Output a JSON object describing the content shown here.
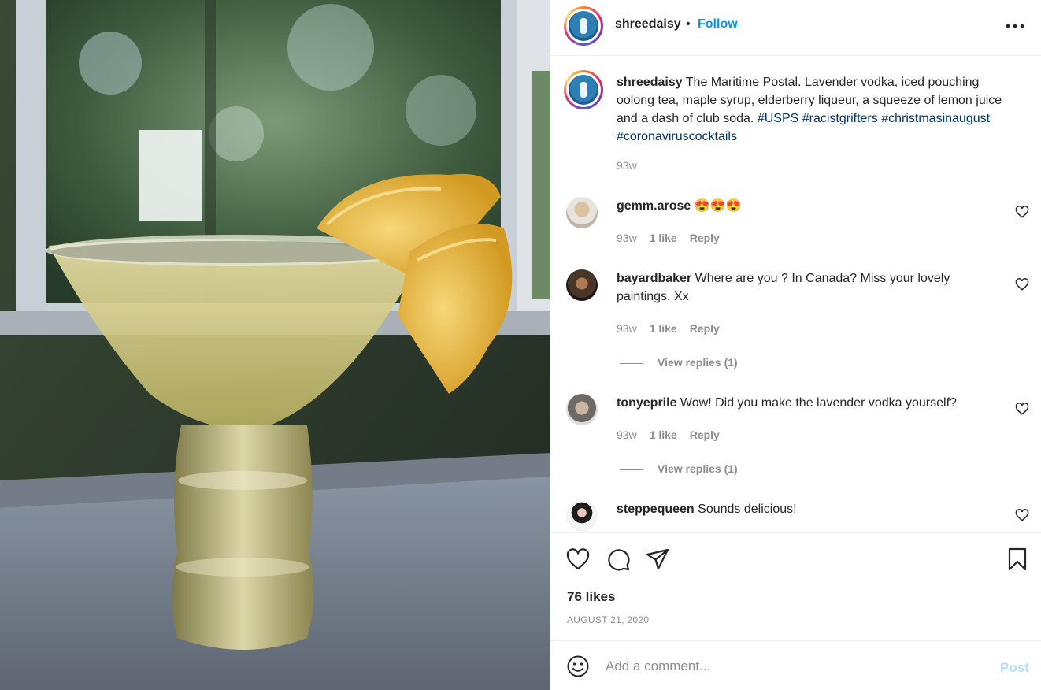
{
  "post": {
    "author": "shreedaisy",
    "separator": "•",
    "follow_label": "Follow",
    "more_icon": "more-horizontal-icon",
    "caption_user": "shreedaisy",
    "caption_text": "The Maritime Postal. Lavender vodka, iced pouching oolong tea, maple syrup, elderberry liqueur, a squeeze of lemon juice and a dash of club soda.",
    "hashtags": [
      "#USPS",
      "#racistgrifters",
      "#christmasinaugust",
      "#coronaviruscocktails"
    ],
    "caption_time": "93w"
  },
  "comments": [
    {
      "user": "gemm.arose",
      "text": "😍😍😍",
      "time": "93w",
      "likes": "1 like",
      "reply": "Reply"
    },
    {
      "user": "bayardbaker",
      "text": "Where are you ? In Canada? Miss your lovely paintings. Xx",
      "time": "93w",
      "likes": "1 like",
      "reply": "Reply",
      "view_replies": "View replies (1)"
    },
    {
      "user": "tonyeprile",
      "text": "Wow! Did you make the lavender vodka yourself?",
      "time": "93w",
      "likes": "1 like",
      "reply": "Reply",
      "view_replies": "View replies (1)"
    },
    {
      "user": "steppequeen",
      "text": "Sounds delicious!"
    }
  ],
  "actions": {
    "like_icon": "heart-icon",
    "comment_icon": "comment-icon",
    "share_icon": "send-icon",
    "save_icon": "bookmark-icon",
    "likes": "76 likes",
    "date": "AUGUST 21, 2020"
  },
  "composer": {
    "emoji_icon": "emoji-icon",
    "placeholder": "Add a comment...",
    "post_label": "Post"
  },
  "colors": {
    "accent": "#0095f6",
    "hashtag": "#00376b",
    "muted": "#8e8e8e",
    "post_disabled": "#b2dffc"
  }
}
